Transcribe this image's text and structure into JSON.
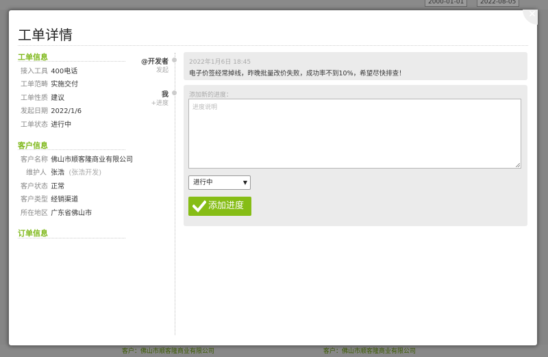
{
  "modal": {
    "title": "工单详情",
    "close_icon": "close-icon"
  },
  "ticket_info": {
    "section_title": "工单信息",
    "rows": [
      {
        "label": "接入工具",
        "value": "400电话"
      },
      {
        "label": "工单范畴",
        "value": "实施交付"
      },
      {
        "label": "工单性质",
        "value": "建议"
      },
      {
        "label": "发起日期",
        "value": "2022/1/6"
      },
      {
        "label": "工单状态",
        "value": "进行中"
      }
    ]
  },
  "customer_info": {
    "section_title": "客户信息",
    "name_label": "客户名称",
    "name_value": "佛山市顺客隆商业有限公司",
    "maintainer_label": "维护人",
    "maintainer_value": "张浩",
    "maintainer_note": "(张浩开发)",
    "status_label": "客户状态",
    "status_value": "正常",
    "type_label": "客户类型",
    "type_value": "经销渠道",
    "region_label": "所在地区",
    "region_value": "广东省佛山市"
  },
  "order_info": {
    "section_title": "订单信息"
  },
  "timeline": {
    "entry1": {
      "author": "@开发者",
      "action": "发起",
      "time": "2022年1月6日 18:45",
      "text": "电子价签经常掉线，昨晚批量改价失败，成功率不到10%，希望尽快排查！"
    },
    "entry2": {
      "author": "我",
      "action": "+进度",
      "label": "添加新的进度：",
      "placeholder": "进度说明",
      "status_selected": "进行中",
      "add_button": "添加进度"
    }
  },
  "background": {
    "date_from": "2000-01-01",
    "date_to": "2022-08-05",
    "footer_text_1": "客户：佛山市顺客隆商业有限公司",
    "footer_text_2": "客户：佛山市顺客隆商业有限公司"
  },
  "colors": {
    "accent": "#7fb81b",
    "button": "#86bd16"
  }
}
